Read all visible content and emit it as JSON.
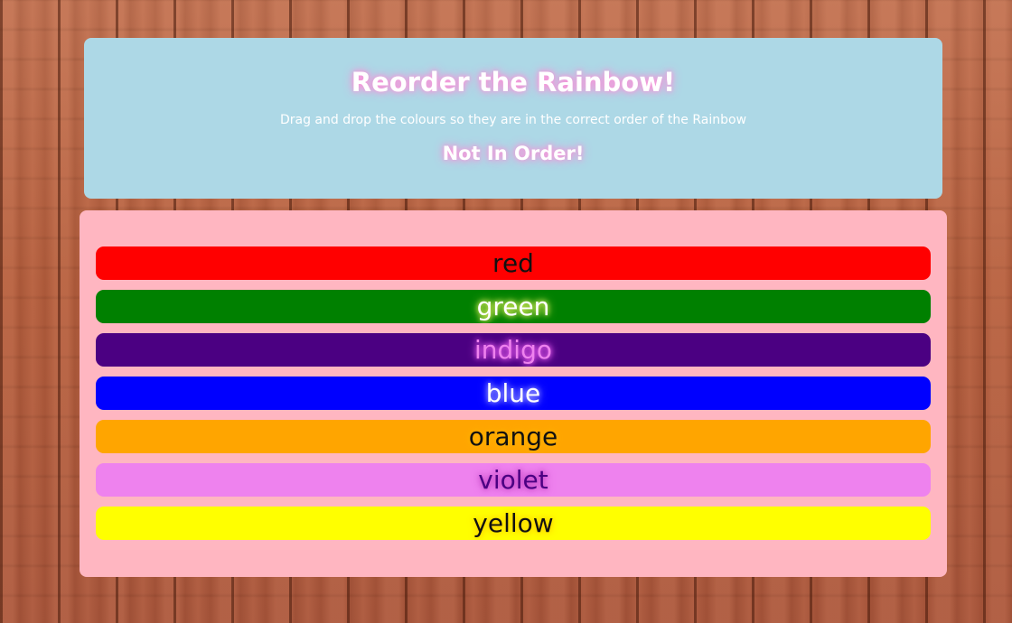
{
  "header": {
    "title": "Reorder the Rainbow!",
    "instructions": "Drag and drop the colours so they are in the correct order of the Rainbow",
    "status": "Not In Order!",
    "background_color": "#add8e6"
  },
  "list": {
    "background_color": "#ffb6c1",
    "items": [
      {
        "label": "red",
        "bg": "#ff0000",
        "text_color": "#111111",
        "glow": "#ff0000"
      },
      {
        "label": "green",
        "bg": "#008000",
        "text_color": "#ffffff",
        "glow": "#ffff66"
      },
      {
        "label": "indigo",
        "bg": "#4b0082",
        "text_color": "#ee82ee",
        "glow": "#ff66ff"
      },
      {
        "label": "blue",
        "bg": "#0000ff",
        "text_color": "#ffffff",
        "glow": "#aaaaff"
      },
      {
        "label": "orange",
        "bg": "#ffa500",
        "text_color": "#111111",
        "glow": "#ffb400"
      },
      {
        "label": "violet",
        "bg": "#ee82ee",
        "text_color": "#4b0082",
        "glow": "#c040c0"
      },
      {
        "label": "yellow",
        "bg": "#ffff00",
        "text_color": "#111111",
        "glow": "#ffcc00"
      }
    ]
  }
}
